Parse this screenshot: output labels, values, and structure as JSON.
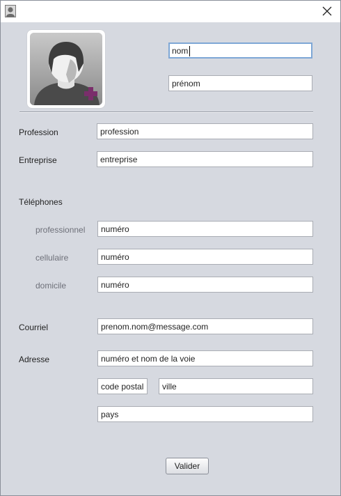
{
  "icons": {
    "app": "user-avatar-icon",
    "close": "close-icon",
    "photo": "add-contact-photo-icon"
  },
  "colors": {
    "accent_plus": "#7a2e6b",
    "focus_border": "#7ea7d6",
    "background": "#d6d9e0"
  },
  "identity": {
    "nom": "nom",
    "prenom": "prénom"
  },
  "profession": {
    "label": "Profession",
    "value": "profession"
  },
  "entreprise": {
    "label": "Entreprise",
    "value": "entreprise"
  },
  "telephones": {
    "heading": "Téléphones",
    "professionnel": {
      "label": "professionnel",
      "value": "numéro"
    },
    "cellulaire": {
      "label": "cellulaire",
      "value": "numéro"
    },
    "domicile": {
      "label": "domicile",
      "value": "numéro"
    }
  },
  "courriel": {
    "label": "Courriel",
    "value": "prenom.nom@message.com"
  },
  "adresse": {
    "label": "Adresse",
    "voie": "numéro et nom de la voie",
    "code_postal": "code postal",
    "ville": "ville",
    "pays": "pays"
  },
  "actions": {
    "validate_label": "Valider"
  }
}
